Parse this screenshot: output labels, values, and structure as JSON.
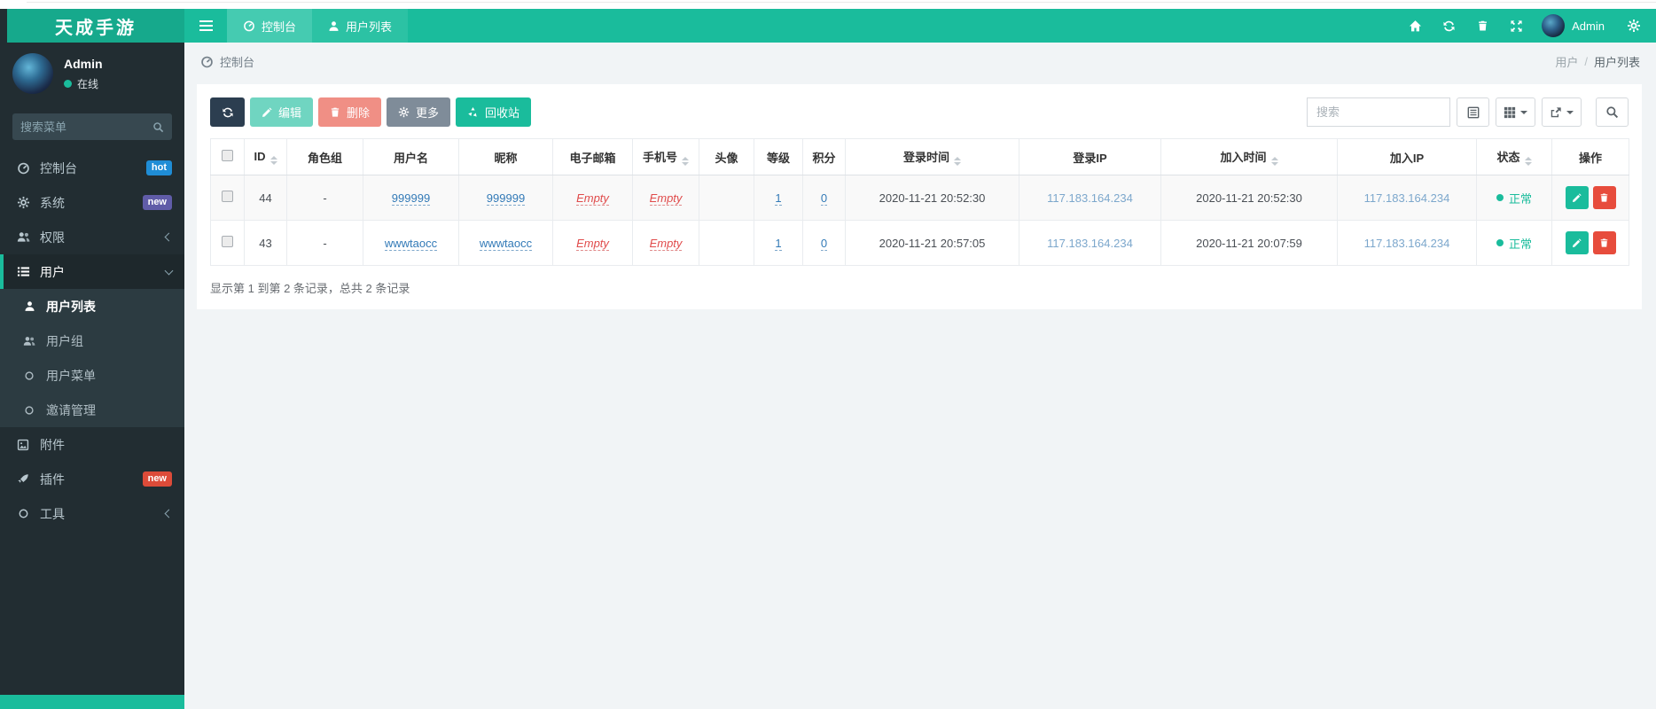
{
  "theme": {
    "accent": "#1abc9c",
    "topbar_logo_bg": "#16a98c",
    "sidebar_bg": "#222d32",
    "submenu_bg": "#2c3b41",
    "dark_button": "#2c3e50",
    "danger": "#e74c3c",
    "gray_button": "#7f8c99",
    "link_blue": "#337ab7",
    "ip_blue": "#7ca7cc",
    "badge_hot_bg": "#1f8dd6",
    "badge_new_purple_bg": "#605ca8",
    "badge_new_red_bg": "#dd4b39",
    "status_ok_color": "#1abc9c"
  },
  "topbar": {
    "logo": "天成手游",
    "tabs": [
      {
        "label": "控制台"
      },
      {
        "label": "用户列表"
      }
    ],
    "user_label": "Admin"
  },
  "sidebar": {
    "user": {
      "name": "Admin",
      "status": "在线"
    },
    "search_placeholder": "搜索菜单",
    "menu": [
      {
        "label": "控制台",
        "badge": "hot"
      },
      {
        "label": "系统",
        "badge": "new"
      },
      {
        "label": "权限"
      },
      {
        "label": "用户"
      },
      {
        "label": "附件"
      },
      {
        "label": "插件",
        "badge": "new"
      },
      {
        "label": "工具"
      }
    ],
    "user_children": [
      "用户列表",
      "用户组",
      "用户菜单",
      "邀请管理"
    ]
  },
  "breadcrumb": {
    "left": "控制台",
    "right_parent": "用户",
    "separator": "/",
    "right_current": "用户列表"
  },
  "toolbar": {
    "edit_label": "编辑",
    "delete_label": "删除",
    "more_label": "更多",
    "recycle_label": "回收站",
    "search_placeholder": "搜索"
  },
  "table": {
    "columns": [
      "ID",
      "角色组",
      "用户名",
      "昵称",
      "电子邮箱",
      "手机号",
      "头像",
      "等级",
      "积分",
      "登录时间",
      "登录IP",
      "加入时间",
      "加入IP",
      "状态",
      "操作"
    ],
    "rows": [
      {
        "id": "44",
        "group": "-",
        "username": "999999",
        "nickname": "999999",
        "email": "Empty",
        "mobile": "Empty",
        "level": "1",
        "score": "0",
        "login_time": "2020-11-21 20:52:30",
        "login_ip": "117.183.164.234",
        "join_time": "2020-11-21 20:52:30",
        "join_ip": "117.183.164.234",
        "status": "正常"
      },
      {
        "id": "43",
        "group": "-",
        "username": "wwwtaocc",
        "nickname": "wwwtaocc",
        "email": "Empty",
        "mobile": "Empty",
        "level": "1",
        "score": "0",
        "login_time": "2020-11-21 20:57:05",
        "login_ip": "117.183.164.234",
        "join_time": "2020-11-21 20:07:59",
        "join_ip": "117.183.164.234",
        "status": "正常"
      }
    ],
    "summary": "显示第 1 到第 2 条记录，总共 2 条记录"
  }
}
